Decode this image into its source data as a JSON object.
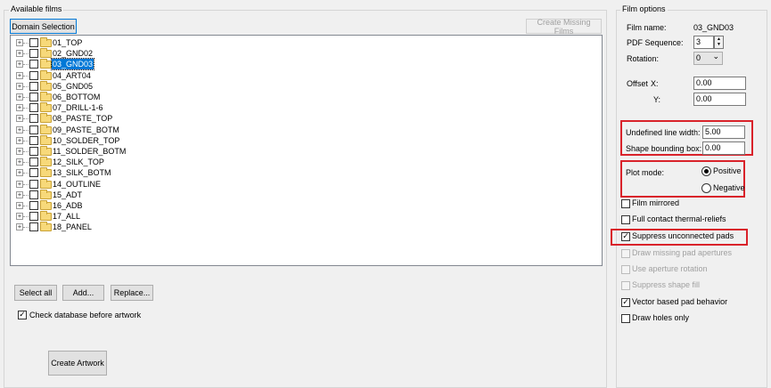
{
  "available_films": {
    "legend": "Available films",
    "domain_selection": "Domain Selection",
    "create_missing_films": "Create Missing Films",
    "films": [
      {
        "label": "01_TOP",
        "selected": false
      },
      {
        "label": "02_GND02",
        "selected": false
      },
      {
        "label": "03_GND03",
        "selected": true
      },
      {
        "label": "04_ART04",
        "selected": false
      },
      {
        "label": "05_GND05",
        "selected": false
      },
      {
        "label": "06_BOTTOM",
        "selected": false
      },
      {
        "label": "07_DRILL-1-6",
        "selected": false
      },
      {
        "label": "08_PASTE_TOP",
        "selected": false
      },
      {
        "label": "09_PASTE_BOTM",
        "selected": false
      },
      {
        "label": "10_SOLDER_TOP",
        "selected": false
      },
      {
        "label": "11_SOLDER_BOTM",
        "selected": false
      },
      {
        "label": "12_SILK_TOP",
        "selected": false
      },
      {
        "label": "13_SILK_BOTM",
        "selected": false
      },
      {
        "label": "14_OUTLINE",
        "selected": false
      },
      {
        "label": "15_ADT",
        "selected": false
      },
      {
        "label": "16_ADB",
        "selected": false
      },
      {
        "label": "17_ALL",
        "selected": false
      },
      {
        "label": "18_PANEL",
        "selected": false
      }
    ],
    "select_all": "Select all",
    "add": "Add...",
    "replace": "Replace...",
    "check_database": {
      "label": "Check database before artwork",
      "checked": true
    },
    "create_artwork": "Create Artwork"
  },
  "film_options": {
    "legend": "Film options",
    "film_name_label": "Film name:",
    "film_name_value": "03_GND03",
    "pdf_sequence_label": "PDF Sequence:",
    "pdf_sequence_value": "3",
    "rotation_label": "Rotation:",
    "rotation_value": "0",
    "offset_label": "Offset",
    "x_label": "X:",
    "x_value": "0.00",
    "y_label": "Y:",
    "y_value": "0.00",
    "undefined_line_width_label": "Undefined line width:",
    "undefined_line_width_value": "5.00",
    "shape_bounding_box_label": "Shape bounding box:",
    "shape_bounding_box_value": "0.00",
    "plot_mode_label": "Plot mode:",
    "plot_mode_options": [
      "Positive",
      "Negative"
    ],
    "plot_mode_selected": "Positive",
    "checkboxes": [
      {
        "label": "Film mirrored",
        "checked": false,
        "enabled": true
      },
      {
        "label": "Full contact thermal-reliefs",
        "checked": false,
        "enabled": true
      },
      {
        "label": "Suppress unconnected pads",
        "checked": true,
        "enabled": true
      },
      {
        "label": "Draw missing pad apertures",
        "checked": false,
        "enabled": false
      },
      {
        "label": "Use aperture rotation",
        "checked": false,
        "enabled": false
      },
      {
        "label": "Suppress shape fill",
        "checked": false,
        "enabled": false
      },
      {
        "label": "Vector based pad behavior",
        "checked": true,
        "enabled": true
      },
      {
        "label": "Draw holes only",
        "checked": false,
        "enabled": true
      }
    ]
  },
  "colors": {
    "highlight_box": "#d9222a",
    "selection": "#0078d7"
  },
  "icons": {
    "check": "✓",
    "expand": "+",
    "spin_up": "▲",
    "spin_down": "▼",
    "dropdown": "⌄"
  }
}
